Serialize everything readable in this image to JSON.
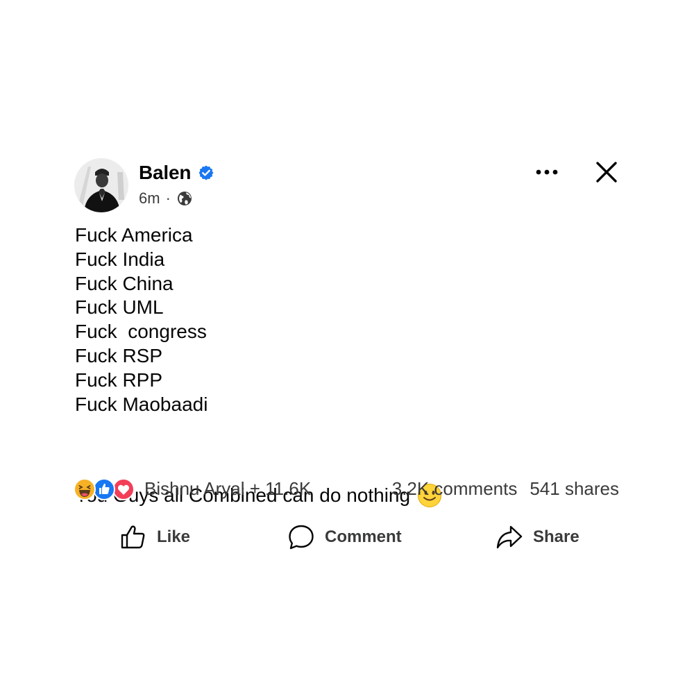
{
  "post": {
    "author": "Balen",
    "author_verified": true,
    "time": "6m",
    "separator": "·",
    "audience_icon": "globe-icon",
    "lines": [
      "Fuck America",
      "Fuck India",
      "Fuck China",
      "Fuck UML",
      "Fuck  congress",
      "Fuck RSP",
      "Fuck RPP",
      "Fuck Maobaadi"
    ],
    "closing_line": "You Guys all Combined can do nothing",
    "closing_emoji": "smile-emoji"
  },
  "header_actions": {
    "more_icon": "more-options-icon",
    "close_icon": "close-icon"
  },
  "reactions": {
    "icons": [
      "haha-reaction",
      "like-reaction",
      "love-reaction"
    ],
    "summary": "Bishnu Aryal + 11.6K",
    "comments": "3.2K comments",
    "shares": "541 shares"
  },
  "actions": {
    "like": "Like",
    "comment": "Comment",
    "share": "Share"
  },
  "colors": {
    "verified_blue": "#1877F2",
    "like_blue": "#1877F2",
    "love_red": "#F33E58",
    "haha_yellow": "#F7B125",
    "text": "#050505",
    "secondary_text": "#3A3B3C"
  }
}
